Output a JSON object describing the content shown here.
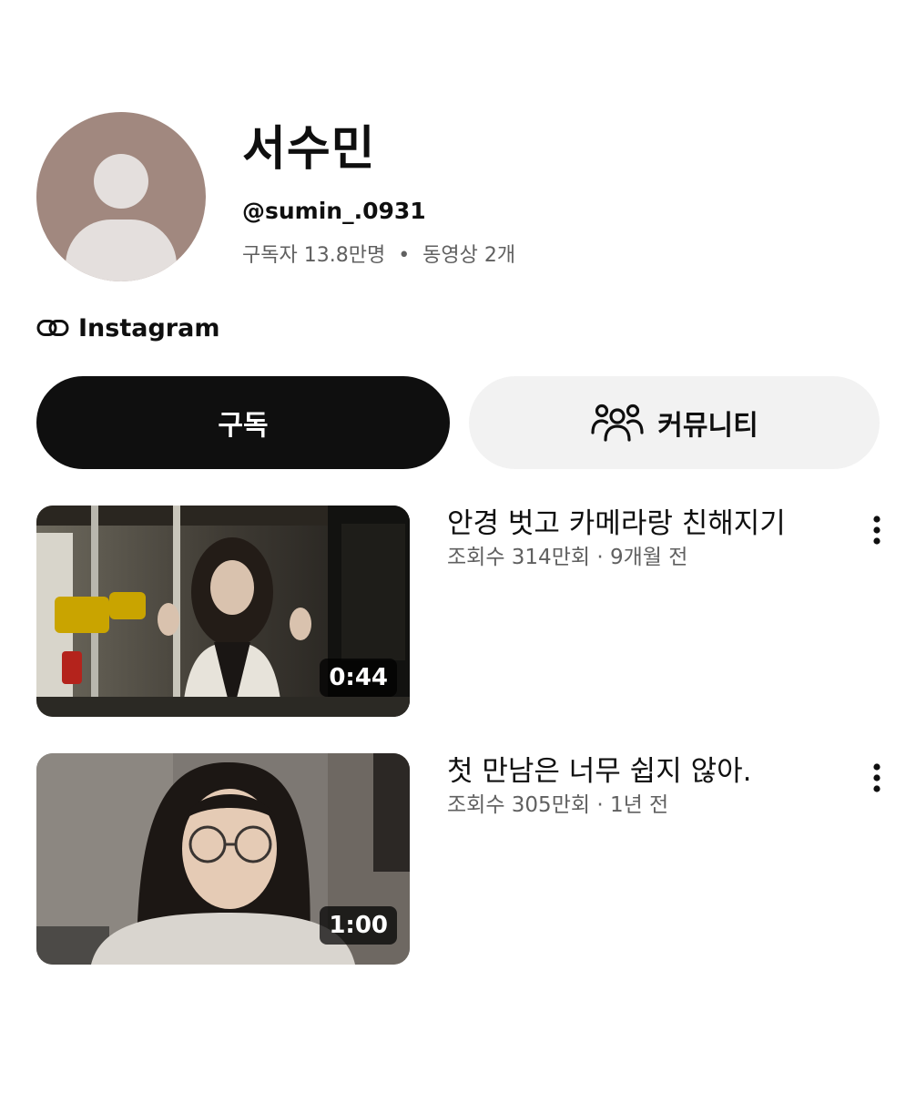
{
  "channel": {
    "name": "서수민",
    "handle": "@sumin_.0931",
    "subscribers": "구독자 13.8만명",
    "separator": "•",
    "video_count": "동영상 2개",
    "link_label": "Instagram"
  },
  "actions": {
    "subscribe_label": "구독",
    "community_label": "커뮤니티"
  },
  "videos": [
    {
      "title": "안경 벗고 카메라랑 친해지기",
      "meta": "조회수 314만회 · 9개월 전",
      "duration": "0:44"
    },
    {
      "title": "첫 만남은 너무 쉽지 않아.",
      "meta": "조회수 305만회 · 1년 전",
      "duration": "1:00"
    }
  ],
  "colors": {
    "subscribe_bg": "#0f0f0f",
    "community_bg": "#f2f2f2",
    "avatar_bg": "#a1887f",
    "meta_text": "#606060"
  },
  "icons": [
    "link-icon",
    "people-icon",
    "more-vertical-icon",
    "default-avatar-icon"
  ]
}
